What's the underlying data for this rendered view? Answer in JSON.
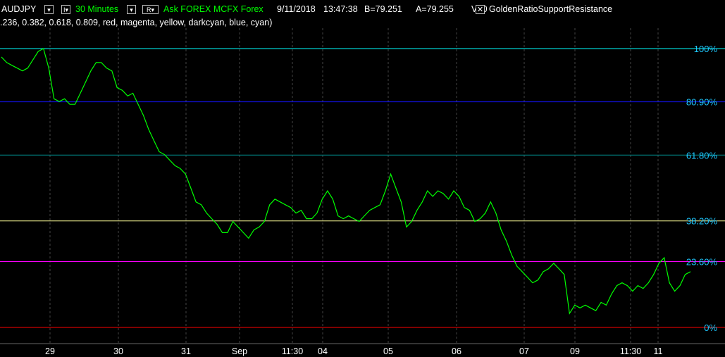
{
  "header": {
    "symbol": "AUDJPY",
    "interval": "30 Minutes",
    "source": "Ask  FOREX  MCFX  Forex",
    "date": "9/11/2018",
    "time": "13:47:38",
    "bid": "B=79.251",
    "ask": "A=79.255",
    "volume": "V=0",
    "indicator": "GoldenRatioSupportResistance",
    "params": ".236,  0.382,  0.618,  0.809,  red,  magenta,  yellow,  darkcyan,  blue,  cyan)"
  },
  "colors": {
    "price": "#00ff00",
    "level_100": "#00ffff",
    "level_809": "#1414ff",
    "level_618": "#008b8b",
    "level_382": "#ffff99",
    "level_236": "#ff00ff",
    "level_0": "#ff0000",
    "label": "#1ec8ff"
  },
  "chart_data": {
    "type": "line",
    "levels": [
      {
        "label": "100%",
        "color": "#00ffff"
      },
      {
        "label": "80.90%",
        "color": "#1414ff"
      },
      {
        "label": "61.80%",
        "color": "#008b8b"
      },
      {
        "label": "38.20%",
        "color": "#ffff99"
      },
      {
        "label": "23.60%",
        "color": "#ff00ff"
      },
      {
        "label": "0%",
        "color": "#ff0000"
      }
    ],
    "level_fractions": [
      1.0,
      0.809,
      0.618,
      0.382,
      0.236,
      0.0
    ],
    "x_ticks": [
      "29",
      "30",
      "31",
      "Sep",
      "11:30",
      "04",
      "05",
      "06",
      "07",
      "09",
      "11:30",
      "11"
    ],
    "series": [
      {
        "values": [
          0.97,
          0.95,
          0.94,
          0.93,
          0.92,
          0.93,
          0.96,
          0.99,
          1.0,
          0.93,
          0.82,
          0.81,
          0.82,
          0.8,
          0.8,
          0.84,
          0.88,
          0.92,
          0.95,
          0.95,
          0.93,
          0.92,
          0.86,
          0.85,
          0.83,
          0.84,
          0.8,
          0.76,
          0.71,
          0.67,
          0.63,
          0.62,
          0.6,
          0.58,
          0.57,
          0.55,
          0.5,
          0.45,
          0.44,
          0.41,
          0.39,
          0.37,
          0.34,
          0.34,
          0.38,
          0.36,
          0.34,
          0.32,
          0.35,
          0.36,
          0.38,
          0.44,
          0.46,
          0.45,
          0.44,
          0.43,
          0.41,
          0.42,
          0.39,
          0.39,
          0.41,
          0.46,
          0.49,
          0.46,
          0.4,
          0.39,
          0.4,
          0.39,
          0.38,
          0.4,
          0.42,
          0.43,
          0.44,
          0.49,
          0.55,
          0.5,
          0.45,
          0.36,
          0.38,
          0.42,
          0.45,
          0.49,
          0.47,
          0.49,
          0.48,
          0.46,
          0.49,
          0.47,
          0.43,
          0.42,
          0.38,
          0.39,
          0.41,
          0.45,
          0.41,
          0.35,
          0.31,
          0.26,
          0.22,
          0.2,
          0.18,
          0.16,
          0.17,
          0.2,
          0.21,
          0.23,
          0.21,
          0.19,
          0.05,
          0.08,
          0.07,
          0.08,
          0.07,
          0.06,
          0.09,
          0.08,
          0.12,
          0.15,
          0.16,
          0.15,
          0.13,
          0.15,
          0.14,
          0.16,
          0.19,
          0.23,
          0.25,
          0.16,
          0.13,
          0.15,
          0.19,
          0.2
        ]
      }
    ]
  }
}
